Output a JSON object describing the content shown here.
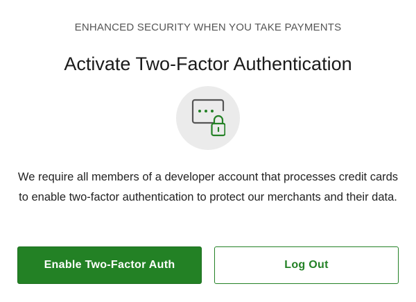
{
  "dialog": {
    "eyebrow": "ENHANCED SECURITY WHEN YOU TAKE PAYMENTS",
    "title": "Activate Two-Factor Authentication",
    "icon": "password-lock-icon",
    "description": "We require all members of a developer account that processes credit cards to enable two-factor authentication to protect our merchants and their data.",
    "primary_button": "Enable Two-Factor Auth",
    "secondary_button": "Log Out"
  },
  "colors": {
    "accent": "#238125",
    "icon_stroke": "#555555",
    "icon_circle": "#ebebeb"
  }
}
